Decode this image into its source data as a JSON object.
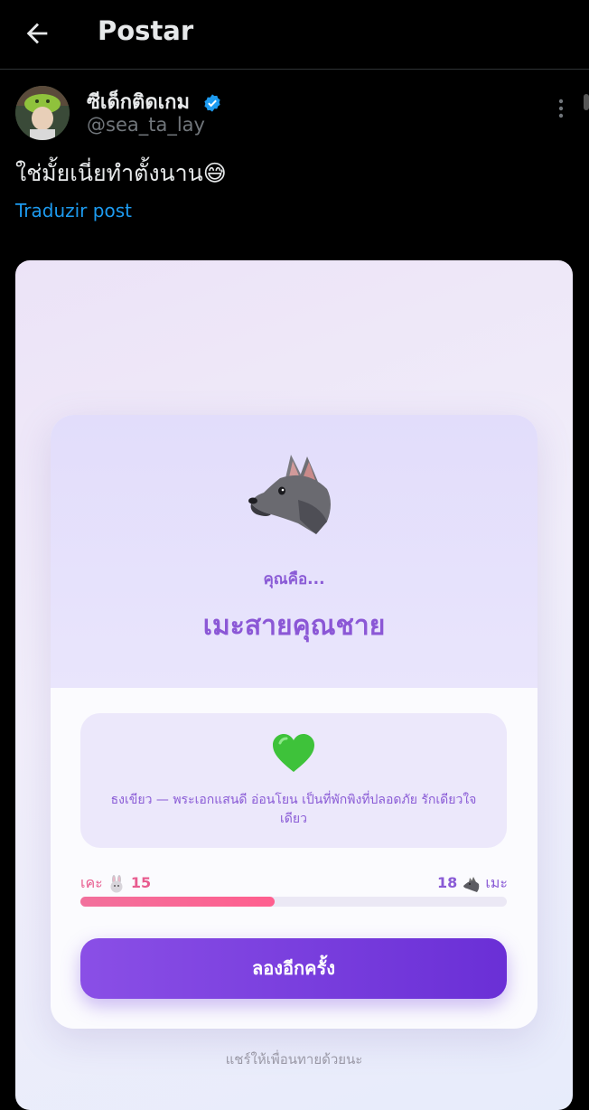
{
  "header": {
    "title": "Postar"
  },
  "post": {
    "author_name": "ซีเด็กติดเกม",
    "handle": "@sea_ta_lay",
    "text": "ใช่มั้ยเนี่ยทำตั้งนาน😅",
    "translate_link": "Traduzir post"
  },
  "quiz_card": {
    "you_are": "คุณคือ...",
    "result_title": "เมะสายคุณชาย",
    "description": "ธงเขียว — พระเอกแสนดี อ่อนโยน เป็นที่พักพิงที่ปลอดภัย รักเดียวใจเดียว",
    "left_label": "เคะ",
    "left_score": "15",
    "right_score": "18",
    "right_label": "เมะ",
    "progress_fraction": 0.4545,
    "button_label": "ลองอีกครั้ง",
    "share_text": "แชร์ให้เพื่อนทายด้วยนะ"
  },
  "icons": {
    "back": "arrow-left-icon",
    "verified": "verified-badge-icon",
    "more": "more-vertical-icon",
    "result": "wolf-icon",
    "heart": "green-heart-icon",
    "left_score": "rabbit-icon",
    "right_score": "wolf-icon"
  },
  "colors": {
    "link": "#1d9bf0",
    "accent_purple": "#8a5bd6",
    "pink": "#e85c8f",
    "button_start": "#8a4fe6",
    "button_end": "#6a2fd6"
  }
}
